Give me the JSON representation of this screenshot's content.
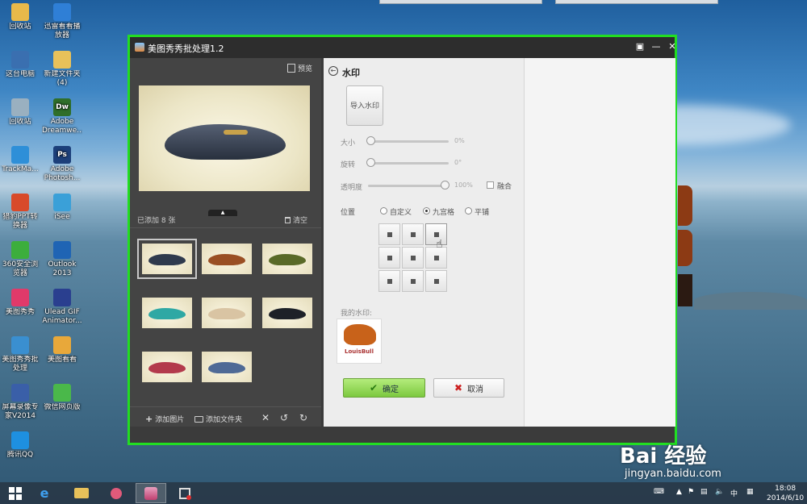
{
  "window": {
    "title": "美图秀秀批处理1.2"
  },
  "left_panel": {
    "preview_label": "预览",
    "added_count": "已添加 8 张",
    "clear_label": "清空",
    "add_image_label": "添加图片",
    "add_folder_label": "添加文件夹",
    "thumbnails": [
      {
        "color": "#2f3a4d",
        "selected": true
      },
      {
        "color": "#9a4f24",
        "selected": false
      },
      {
        "color": "#5a6a28",
        "selected": false
      },
      {
        "color": "#2fa8a4",
        "selected": false
      },
      {
        "color": "#d9c4a3",
        "selected": false
      },
      {
        "color": "#1e2128",
        "selected": false
      },
      {
        "color": "#b33a4c",
        "selected": false
      },
      {
        "color": "#4f6a96",
        "selected": false
      }
    ]
  },
  "watermark_panel": {
    "title": "水印",
    "import_label": "导入水印",
    "size_label": "大小",
    "size_value": "0%",
    "rotate_label": "旋转",
    "rotate_value": "0°",
    "opacity_label": "透明度",
    "opacity_value": "100%",
    "blend_label": "融合",
    "position_label": "位置",
    "position_options": [
      "自定义",
      "九宫格",
      "平铺"
    ],
    "selected_position": "九宫格",
    "active_grid_cell": "top-right",
    "my_watermark_label": "我的水印:",
    "watermark_text": "LouisBull",
    "ok_label": "确定",
    "cancel_label": "取消"
  },
  "desktop_icons": [
    {
      "label": "回收站",
      "color": "#e8b94a"
    },
    {
      "label": "迅雷看看播放器",
      "color": "#2f7fd6"
    },
    {
      "label": "这台电脑",
      "color": "#3a6fb0"
    },
    {
      "label": "新建文件夹(4)",
      "color": "#e8c15a"
    },
    {
      "label": "回收站",
      "color": "#9ab0c0"
    },
    {
      "label": "Adobe Dreamwe...",
      "color": "#2f6e2a",
      "abbr": "Dw"
    },
    {
      "label": "TrackMa...",
      "color": "#2e8fd8"
    },
    {
      "label": "Adobe Photosh...",
      "color": "#1c3f7a",
      "abbr": "Ps"
    },
    {
      "label": "猎豹PPT转换器",
      "color": "#d84a2a"
    },
    {
      "label": "iSee",
      "color": "#3aa0d8"
    },
    {
      "label": "360安全浏览器",
      "color": "#3cae3c"
    },
    {
      "label": "Outlook 2013",
      "color": "#1f64b4"
    },
    {
      "label": "美图秀秀",
      "color": "#e03a6a"
    },
    {
      "label": "Ulead GIF Animator...",
      "color": "#2a3f8f"
    },
    {
      "label": "美图秀秀批处理",
      "color": "#3a8fd0"
    },
    {
      "label": "美图看看",
      "color": "#e8a83a"
    },
    {
      "label": "屏幕录像专家V2014",
      "color": "#3a5fa8"
    },
    {
      "label": "微信网页版",
      "color": "#4ab84a"
    },
    {
      "label": "腾讯QQ",
      "color": "#1e90e0"
    }
  ],
  "baidu_watermark": {
    "logo": "Bai 经验",
    "url": "jingyan.baidu.com"
  },
  "taskbar": {
    "time": "18:08",
    "date": "2014/6/10",
    "ime": "中"
  },
  "colors": {
    "window_border": "#22dd22",
    "ok_button": "#8fd24f"
  }
}
